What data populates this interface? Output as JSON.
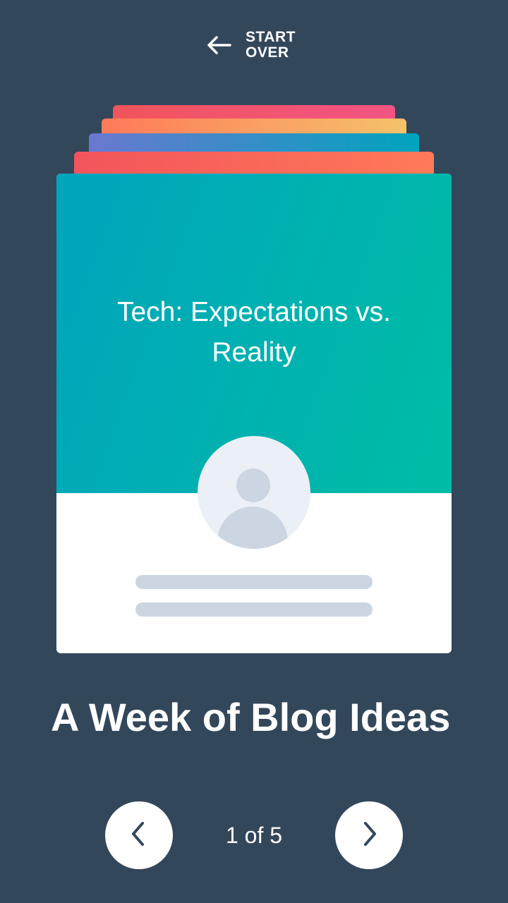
{
  "header": {
    "start_over_line1": "START",
    "start_over_line2": "OVER",
    "back_icon": "arrow-left-icon"
  },
  "card": {
    "title": "Tech: Expectations vs. Reality",
    "avatar_icon": "user-avatar-icon"
  },
  "page": {
    "heading": "A Week of Blog Ideas"
  },
  "pagination": {
    "text": "1 of 5",
    "current": 1,
    "total": 5,
    "prev_icon": "chevron-left-icon",
    "next_icon": "chevron-right-icon"
  },
  "colors": {
    "background": "#33475b",
    "card_header_start": "#00a4bd",
    "card_header_end": "#00bda5",
    "placeholder": "#cbd6e2",
    "avatar_bg": "#eaf0f6",
    "stack_1": [
      "#f2545b",
      "#ff7a59"
    ],
    "stack_2": [
      "#6a78d1",
      "#00a4bd"
    ],
    "stack_3": [
      "#ff7a59",
      "#f5c26b"
    ],
    "stack_4": [
      "#f2545b",
      "#f25484"
    ]
  }
}
